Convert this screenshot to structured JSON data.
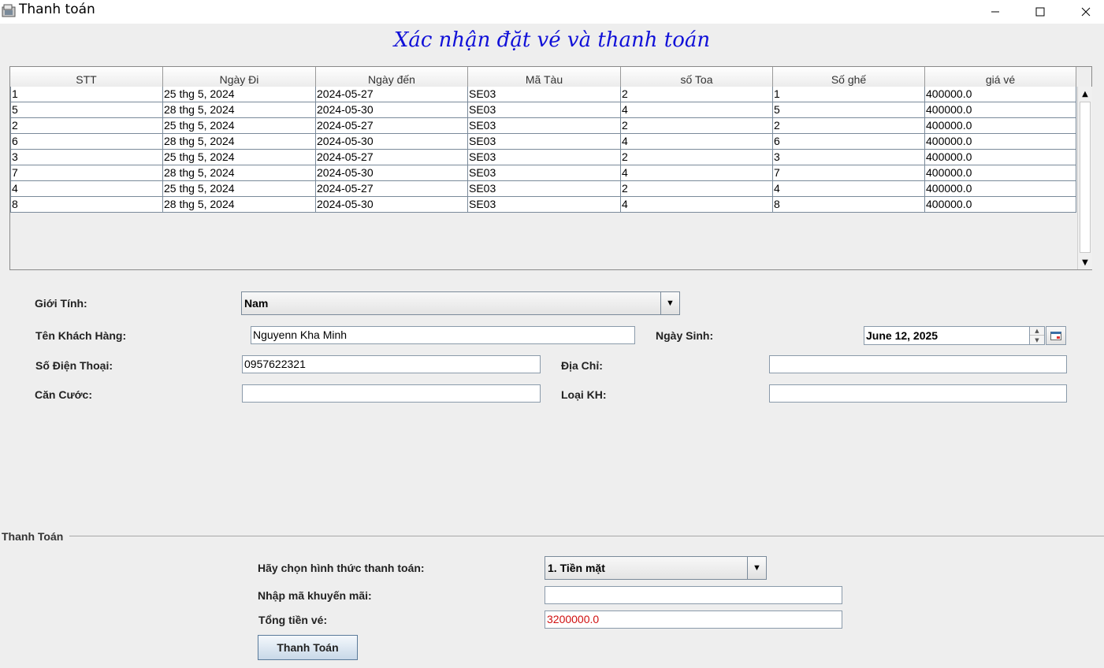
{
  "window": {
    "title": "Thanh toán",
    "min_icon": "minimize-icon",
    "max_icon": "maximize-icon",
    "close_icon": "close-icon"
  },
  "heading": "Xác nhận đặt vé và thanh toán",
  "table": {
    "columns": [
      "STT",
      "Ngày Đi",
      "Ngày đến",
      "Mã Tàu",
      "số Toa",
      "Số ghế",
      "giá vé"
    ],
    "rows": [
      [
        "1",
        "25 thg 5, 2024",
        "2024-05-27",
        "SE03",
        "2",
        "1",
        "400000.0"
      ],
      [
        "5",
        "28 thg 5, 2024",
        "2024-05-30",
        "SE03",
        "4",
        "5",
        "400000.0"
      ],
      [
        "2",
        "25 thg 5, 2024",
        "2024-05-27",
        "SE03",
        "2",
        "2",
        "400000.0"
      ],
      [
        "6",
        "28 thg 5, 2024",
        "2024-05-30",
        "SE03",
        "4",
        "6",
        "400000.0"
      ],
      [
        "3",
        "25 thg 5, 2024",
        "2024-05-27",
        "SE03",
        "2",
        "3",
        "400000.0"
      ],
      [
        "7",
        "28 thg 5, 2024",
        "2024-05-30",
        "SE03",
        "4",
        "7",
        "400000.0"
      ],
      [
        "4",
        "25 thg 5, 2024",
        "2024-05-27",
        "SE03",
        "2",
        "4",
        "400000.0"
      ],
      [
        "8",
        "28 thg 5, 2024",
        "2024-05-30",
        "SE03",
        "4",
        "8",
        "400000.0"
      ]
    ]
  },
  "form": {
    "gender_label": "Giới Tính:",
    "gender_value": "Nam",
    "name_label": "Tên Khách Hàng:",
    "name_value": "Nguyenn Kha Minh",
    "dob_label": "Ngày Sinh:",
    "dob_value": "June 12, 2025",
    "phone_label": "Số Điện Thoại:",
    "phone_value": "0957622321",
    "address_label": "Địa Chỉ:",
    "address_value": "",
    "id_label": "Căn Cước:",
    "id_value": "",
    "customer_type_label": "Loại KH:",
    "customer_type_value": ""
  },
  "payment": {
    "section_title": "Thanh Toán",
    "method_label": "Hãy chọn hình thức thanh toán:",
    "method_value": "1. Tiền mặt",
    "promo_label": "Nhập mã khuyến mãi:",
    "promo_value": "",
    "total_label": "Tổng tiền vé:",
    "total_value": "3200000.0",
    "pay_button": "Thanh Toán"
  },
  "colors": {
    "heading": "#1010d8",
    "total_text": "#d01010"
  }
}
